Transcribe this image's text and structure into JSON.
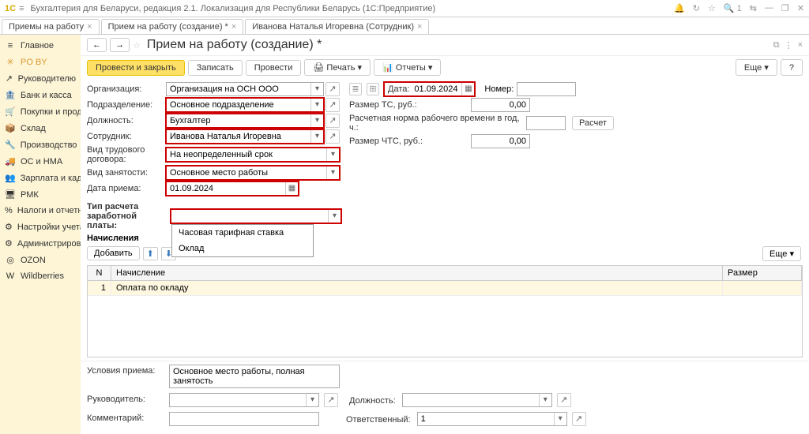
{
  "app": {
    "subtitle": "Бухгалтерия для Беларуси, редакция 2.1. Локализация для Республики Беларусь  (1С:Предприятие)"
  },
  "tabs": [
    {
      "label": "Приемы на работу"
    },
    {
      "label": "Прием на работу (создание) *",
      "active": true
    },
    {
      "label": "Иванова Наталья Игоревна (Сотрудник)"
    }
  ],
  "nav": [
    {
      "label": "Главное",
      "icon": "≡"
    },
    {
      "label": "PO BY",
      "icon": "✳",
      "active": true
    },
    {
      "label": "Руководителю",
      "icon": "↗"
    },
    {
      "label": "Банк и касса",
      "icon": "🏦"
    },
    {
      "label": "Покупки и продажи",
      "icon": "🛒"
    },
    {
      "label": "Склад",
      "icon": "📦"
    },
    {
      "label": "Производство",
      "icon": "🔧"
    },
    {
      "label": "ОС и НМА",
      "icon": "🚚"
    },
    {
      "label": "Зарплата и кадры",
      "icon": "👥"
    },
    {
      "label": "РМК",
      "icon": "🖥"
    },
    {
      "label": "Налоги и отчетность",
      "icon": "%"
    },
    {
      "label": "Настройки учета",
      "icon": "⚙"
    },
    {
      "label": "Администрирование",
      "icon": "⚙"
    },
    {
      "label": "OZON",
      "icon": "◎"
    },
    {
      "label": "Wildberries",
      "icon": "W"
    }
  ],
  "page": {
    "title": "Прием на работу (создание) *"
  },
  "toolbar": {
    "post_close": "Провести и закрыть",
    "write": "Записать",
    "post": "Провести",
    "print": "Печать",
    "reports": "Отчеты",
    "more": "Еще",
    "help": "?"
  },
  "form": {
    "labels": {
      "org": "Организация:",
      "dept": "Подразделение:",
      "pos": "Должность:",
      "emp": "Сотрудник:",
      "contract": "Вид трудового договора:",
      "emptype": "Вид занятости:",
      "hiredate": "Дата приема:",
      "date": "Дата:",
      "number": "Номер:",
      "rate_ts": "Размер ТС, руб.:",
      "norm": "Расчетная норма рабочего времени в год, ч.:",
      "calc": "Расчет",
      "rate_chts": "Размер ЧТС, руб.:",
      "salary_type": "Тип расчета заработной платы:",
      "accruals": "Начисления",
      "add": "Добавить",
      "more2": "Еще"
    },
    "values": {
      "org": "Организация на ОСН ООО",
      "dept": "Основное подразделение",
      "pos": "Бухгалтер",
      "emp": "Иванова Наталья Игоревна",
      "contract": "На неопределенный срок",
      "emptype": "Основное место работы",
      "hiredate": "01.09.2024",
      "date": "01.09.2024",
      "rate_ts": "0,00",
      "rate_chts": "0,00",
      "norm": ""
    },
    "dropdown": [
      "Часовая тарифная ставка",
      "Оклад"
    ]
  },
  "table": {
    "cols": {
      "n": "N",
      "name": "Начисление",
      "size": "Размер"
    },
    "rows": [
      {
        "n": "1",
        "name": "Оплата по окладу"
      }
    ]
  },
  "bottom": {
    "cond_label": "Условия приема:",
    "cond_value": "Основное место работы, полная занятость",
    "mgr_label": "Руководитель:",
    "pos2_label": "Должность:",
    "comment_label": "Комментарий:",
    "resp_label": "Ответственный:",
    "resp_value": "1"
  }
}
